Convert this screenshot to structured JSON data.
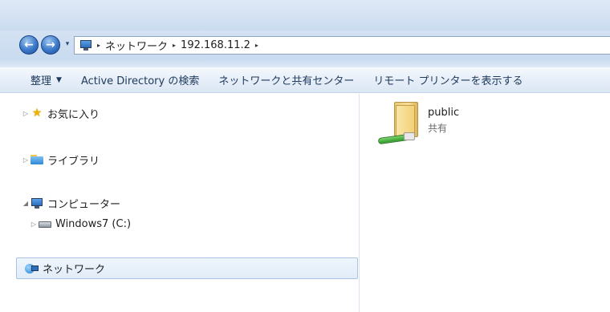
{
  "address": {
    "crumbs": [
      "ネットワーク",
      "192.168.11.2"
    ],
    "history_glyph": "▾",
    "back_glyph": "←",
    "forward_glyph": "→",
    "separator_glyph": "▸"
  },
  "toolbar": {
    "organize_label": "整理",
    "organize_caret": "▼",
    "active_directory_label": "Active Directory の検索",
    "network_center_label": "ネットワークと共有センター",
    "remote_printers_label": "リモート プリンターを表示する"
  },
  "nav": {
    "favorites": {
      "expander": "▷",
      "icon": "star-icon",
      "label": "お気に入り"
    },
    "libraries": {
      "expander": "▷",
      "icon": "library-icon",
      "label": "ライブラリ"
    },
    "computer": {
      "expander": "◢",
      "icon": "computer-icon",
      "label": "コンピューター"
    },
    "drive": {
      "expander": "▷",
      "icon": "drive-icon",
      "label": "Windows7 (C:)"
    },
    "network": {
      "icon": "network-icon",
      "label": "ネットワーク",
      "selected": true
    }
  },
  "content": {
    "items": [
      {
        "icon": "shared-folder-icon",
        "name": "public",
        "type": "共有"
      }
    ]
  },
  "colors": {
    "accent": "#3b78c8",
    "selection_border": "#a8c5e8",
    "folder": "#f3d178"
  }
}
